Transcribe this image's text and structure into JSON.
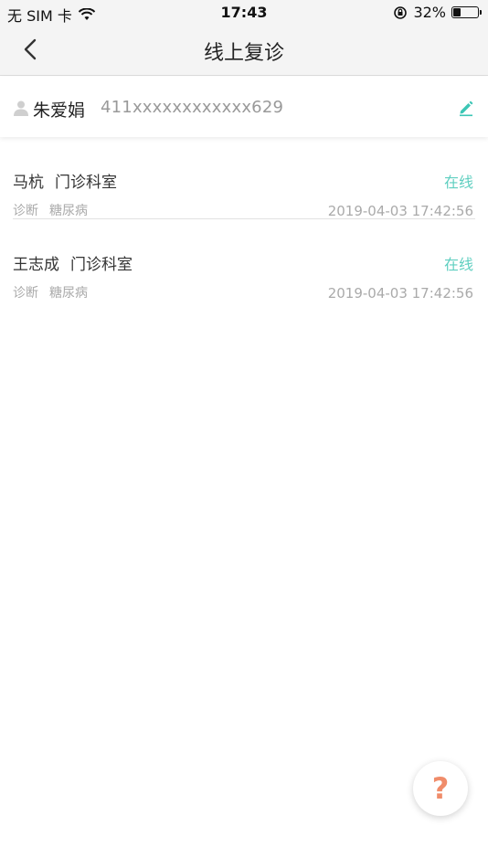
{
  "status_bar": {
    "carrier": "无 SIM 卡",
    "time": "17:43",
    "battery_percent": "32%",
    "battery_level": 0.32,
    "icons": [
      "wifi-icon",
      "rotation-lock-icon",
      "battery-icon"
    ]
  },
  "nav": {
    "title": "线上复诊",
    "back_icon": "chevron-left-icon"
  },
  "patient": {
    "name": "朱爱娟",
    "id_number": "411xxxxxxxxxxxx629",
    "edit_icon": "edit-pencil-icon"
  },
  "visits": [
    {
      "doctor": "马杭",
      "department": "门诊科室",
      "status": "在线",
      "diagnosis_label": "诊断",
      "diagnosis": "糖尿病",
      "time": "2019-04-03 17:42:56"
    },
    {
      "doctor": "王志成",
      "department": "门诊科室",
      "status": "在线",
      "diagnosis_label": "诊断",
      "diagnosis": "糖尿病",
      "time": "2019-04-03 17:42:56"
    }
  ],
  "help": {
    "label": "?"
  },
  "colors": {
    "accent": "#5fcfc0",
    "help": "#f08c6a",
    "muted": "#aaaaaa"
  }
}
